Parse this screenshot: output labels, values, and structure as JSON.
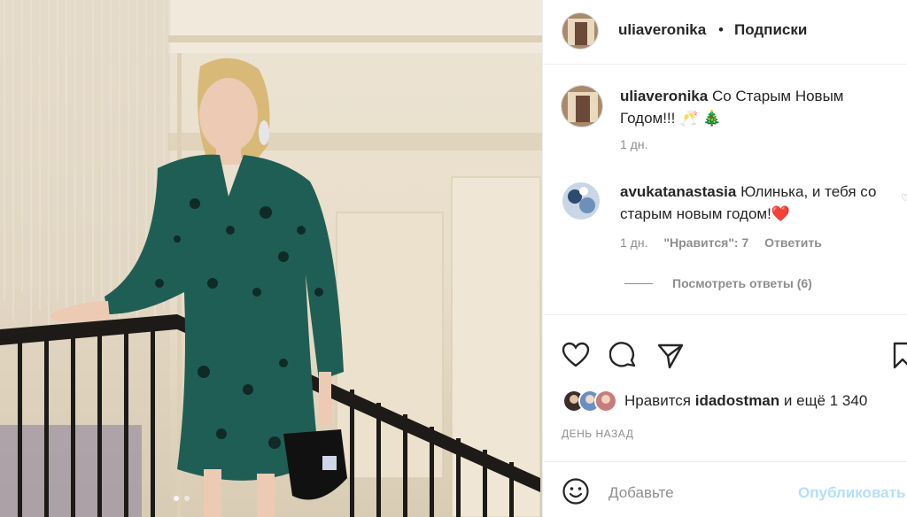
{
  "post": {
    "username": "uliaveronika",
    "separator": "•",
    "follow_label": "Подписки"
  },
  "caption": {
    "username": "uliaveronika",
    "text": "Со Старым Новым Годом!!! 🥂 🎄",
    "time": "1 дн."
  },
  "comments": [
    {
      "username": "avukatanastasia",
      "text": "Юлинька, и тебя со старым новым годом!❤️",
      "time": "1 дн.",
      "likes": "\"Нравится\": 7",
      "reply_label": "Ответить",
      "view_replies": "Посмотреть ответы (6)"
    }
  ],
  "likes": {
    "prefix": "Нравится",
    "user": "idadostman",
    "suffix": "и ещё 1 340"
  },
  "date_label": "ДЕНЬ НАЗАД",
  "add_comment": {
    "placeholder": "Добавьте",
    "publish_label": "Опубликовать"
  },
  "colors": {
    "text": "#262626",
    "muted": "#8e8e8e",
    "link_disabled": "#b2dffc",
    "dress": "#1f5e55"
  }
}
